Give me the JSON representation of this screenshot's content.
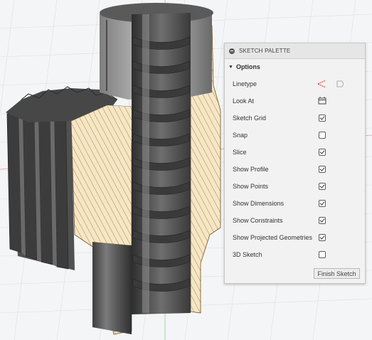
{
  "palette": {
    "title": "SKETCH PALETTE",
    "section": "Options",
    "rows": [
      {
        "label": "Linetype",
        "control": "icons"
      },
      {
        "label": "Look At",
        "control": "icon"
      },
      {
        "label": "Sketch Grid",
        "checked": true
      },
      {
        "label": "Snap",
        "checked": false
      },
      {
        "label": "Slice",
        "checked": true
      },
      {
        "label": "Show Profile",
        "checked": true
      },
      {
        "label": "Show Points",
        "checked": true
      },
      {
        "label": "Show Dimensions",
        "checked": true
      },
      {
        "label": "Show Constraints",
        "checked": true
      },
      {
        "label": "Show Projected Geometries",
        "checked": true
      },
      {
        "label": "3D Sketch",
        "checked": false
      }
    ],
    "finish_label": "Finish Sketch"
  },
  "colors": {
    "highlight": "#d9232e",
    "section_fill": "#f6e6c4",
    "metal": "#5a5a5a"
  }
}
